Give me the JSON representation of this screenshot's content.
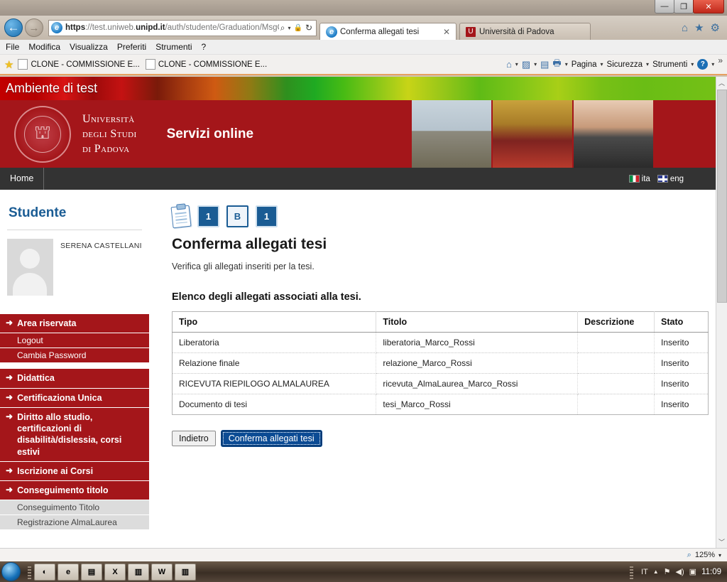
{
  "window": {
    "minimize": "—",
    "maximize": "❐",
    "close": "✕"
  },
  "browser": {
    "back_icon": "←",
    "forward_icon": "→",
    "url": "https://test.uniweb.unipd.it/auth/studente/Graduation/MsgCo",
    "url_scheme": "https",
    "url_sep": "://test.uniweb.",
    "url_domain": "unipd.it",
    "url_path": "/auth/studente/Graduation/MsgCo",
    "search_icon": "⌕",
    "search_caret": "▾",
    "lock_icon": "🔒",
    "refresh_icon": "↻",
    "tabs": [
      {
        "title": "Conferma allegati tesi",
        "close": "✕",
        "active": true
      },
      {
        "title": "Università di Padova",
        "favicon": "U",
        "active": false
      }
    ],
    "nav_icons": [
      {
        "name": "home-icon",
        "glyph": "⌂"
      },
      {
        "name": "favorites-star-icon",
        "glyph": "★"
      },
      {
        "name": "settings-gear-icon",
        "glyph": "⚙"
      }
    ],
    "menu": [
      "File",
      "Modifica",
      "Visualizza",
      "Preferiti",
      "Strumenti",
      "?"
    ],
    "favorites": {
      "star_icon": "★",
      "items": [
        "CLONE - COMMISSIONE E...",
        "CLONE - COMMISSIONE E..."
      ]
    },
    "command_bar": {
      "home_icon": "⌂",
      "feeds_icon": "📶",
      "mail_icon": "✉",
      "print_icon": "🖶",
      "caret": "▾",
      "items": [
        "Pagina",
        "Sicurezza",
        "Strumenti"
      ],
      "help_icon": "?",
      "overflow": "»"
    }
  },
  "test_banner": {
    "label": "Ambiente di test"
  },
  "site_header": {
    "university_line1": "Università",
    "university_line2": "degli Studi",
    "university_line3": "di Padova",
    "service_title": "Servizi online",
    "crest_icon": "crest"
  },
  "nav": {
    "home": "Home",
    "languages": [
      {
        "code": "ita",
        "flag": "it"
      },
      {
        "code": "eng",
        "flag": "en"
      }
    ]
  },
  "sidebar": {
    "title": "Studente",
    "user_name": "SERENA CASTELLANI",
    "groups": [
      {
        "label": "Area riservata",
        "arrow": "➜",
        "children": [
          "Logout",
          "Cambia Password"
        ],
        "child_style": "red"
      },
      {
        "label": "Didattica",
        "arrow": "➜",
        "children": [],
        "child_style": "red"
      },
      {
        "label": "Certificaziona Unica",
        "arrow": "➜",
        "children": [],
        "child_style": "red"
      },
      {
        "label": "Diritto allo studio, certificazioni di disabilità/dislessia, corsi estivi",
        "arrow": "➜",
        "children": [],
        "child_style": "red"
      },
      {
        "label": "Iscrizione ai Corsi",
        "arrow": "➜",
        "children": [],
        "child_style": "red"
      },
      {
        "label": "Conseguimento titolo",
        "arrow": "➜",
        "children": [
          "Conseguimento Titolo",
          "Registrazione AlmaLaurea"
        ],
        "child_style": "gray"
      }
    ]
  },
  "main": {
    "clipboard_icon": "clipboard-checklist",
    "steps": [
      {
        "label": "1",
        "state": "filled"
      },
      {
        "label": "B",
        "state": "open"
      },
      {
        "label": "1",
        "state": "filled"
      }
    ],
    "title": "Conferma allegati tesi",
    "subtitle": "Verifica gli allegati inseriti per la tesi.",
    "section_title": "Elenco degli allegati associati alla tesi.",
    "table": {
      "headers": [
        "Tipo",
        "Titolo",
        "Descrizione",
        "Stato"
      ],
      "rows": [
        [
          "Liberatoria",
          "liberatoria_Marco_Rossi",
          "",
          "Inserito"
        ],
        [
          "Relazione finale",
          "relazione_Marco_Rossi",
          "",
          "Inserito"
        ],
        [
          "RICEVUTA RIEPILOGO ALMALAUREA",
          "ricevuta_AlmaLaurea_Marco_Rossi",
          "",
          "Inserito"
        ],
        [
          "Documento di tesi",
          "tesi_Marco_Rossi",
          "",
          "Inserito"
        ]
      ]
    },
    "buttons": {
      "back": "Indietro",
      "confirm": "Conferma allegati tesi"
    }
  },
  "scrollbar": {
    "up_arrow": "︿",
    "down_arrow": "﹀"
  },
  "status_bar": {
    "zoom_icon": "⌕",
    "zoom_level": "125%",
    "caret": "▾"
  },
  "taskbar": {
    "start_label": "",
    "buttons": [
      {
        "name": "taskbar-item-1",
        "glyph": "◐"
      },
      {
        "name": "taskbar-item-ie",
        "glyph": "e"
      },
      {
        "name": "taskbar-item-folder",
        "glyph": "▤"
      },
      {
        "name": "taskbar-item-excel",
        "glyph": "X"
      },
      {
        "name": "taskbar-item-app1",
        "glyph": "▥"
      },
      {
        "name": "taskbar-item-word",
        "glyph": "W"
      },
      {
        "name": "taskbar-item-app2",
        "glyph": "▥"
      }
    ],
    "tray": {
      "language": "IT",
      "show_hidden": "▲",
      "network_icon": "▮",
      "volume_icon": "◀))",
      "action_icon": "▣",
      "clock": "11:09"
    }
  },
  "colors": {
    "brand_red": "#a4161a",
    "accent_blue": "#1a5c94",
    "button_blue": "#0b4b94",
    "dark_nav": "#333333"
  }
}
